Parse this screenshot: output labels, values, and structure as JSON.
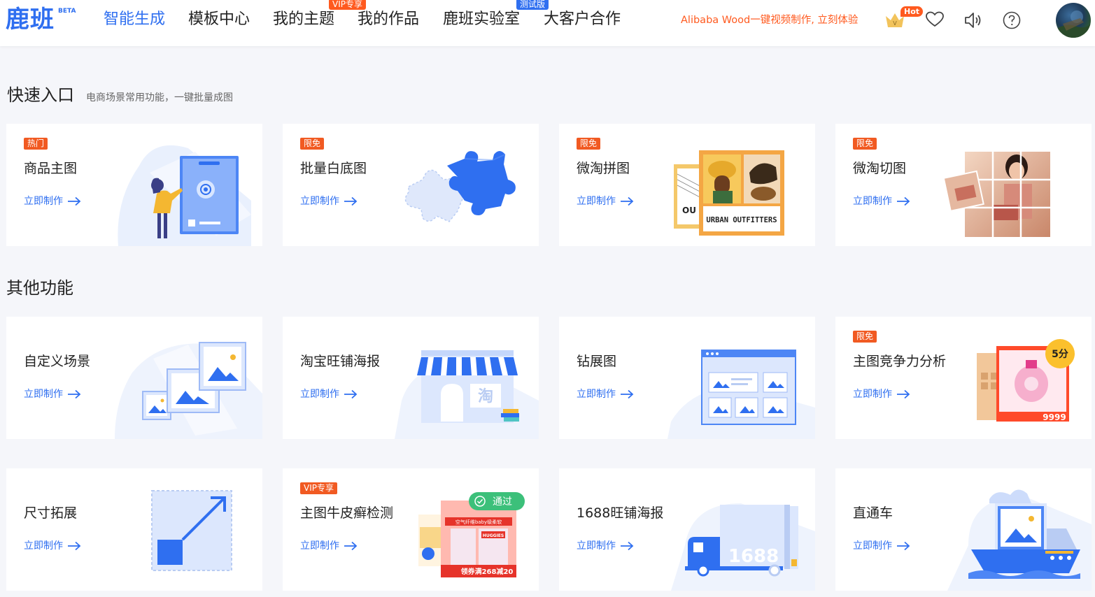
{
  "header": {
    "logo": "鹿班",
    "logo_badge": "BETA",
    "nav": [
      {
        "label": "智能生成",
        "active": true
      },
      {
        "label": "模板中心"
      },
      {
        "label": "我的主题",
        "badge": "VIP专享"
      },
      {
        "label": "我的作品"
      },
      {
        "label": "鹿班实验室",
        "badge": "测试版"
      },
      {
        "label": "大客户合作"
      }
    ],
    "promo": "Alibaba Wood一键视频制作, 立刻体验",
    "hot_badge": "Hot",
    "icons": [
      "crown-icon",
      "heart-icon",
      "speaker-icon",
      "help-icon"
    ]
  },
  "quick": {
    "title": "快速入口",
    "subtitle": "电商场景常用功能，一键批量成图",
    "cards": [
      {
        "tag": "热门",
        "title": "商品主图",
        "action": "立即制作"
      },
      {
        "tag": "限免",
        "title": "批量白底图",
        "action": "立即制作"
      },
      {
        "tag": "限免",
        "title": "微淘拼图",
        "action": "立即制作",
        "illus_text": "URBAN OUTFITTERS"
      },
      {
        "tag": "限免",
        "title": "微淘切图",
        "action": "立即制作"
      }
    ]
  },
  "other": {
    "title": "其他功能",
    "cards": [
      {
        "title": "自定义场景",
        "action": "立即制作"
      },
      {
        "title": "淘宝旺铺海报",
        "action": "立即制作",
        "illus_text": "淘"
      },
      {
        "title": "钻展图",
        "action": "立即制作"
      },
      {
        "tag": "限免",
        "title": "主图竞争力分析",
        "action": "立即制作",
        "score": "5分",
        "price": "9999"
      },
      {
        "title": "尺寸拓展",
        "action": "立即制作"
      },
      {
        "tag": "VIP专享",
        "title": "主图牛皮癣检测",
        "action": "立即制作",
        "pass": "通过",
        "banner_text": "空气纤维baby级柔软",
        "price_text": "领券满268减20",
        "brand": "HUGGIES"
      },
      {
        "title": "1688旺铺海报",
        "action": "立即制作",
        "illus_text": "1688"
      },
      {
        "title": "直通车",
        "action": "立即制作"
      }
    ]
  }
}
